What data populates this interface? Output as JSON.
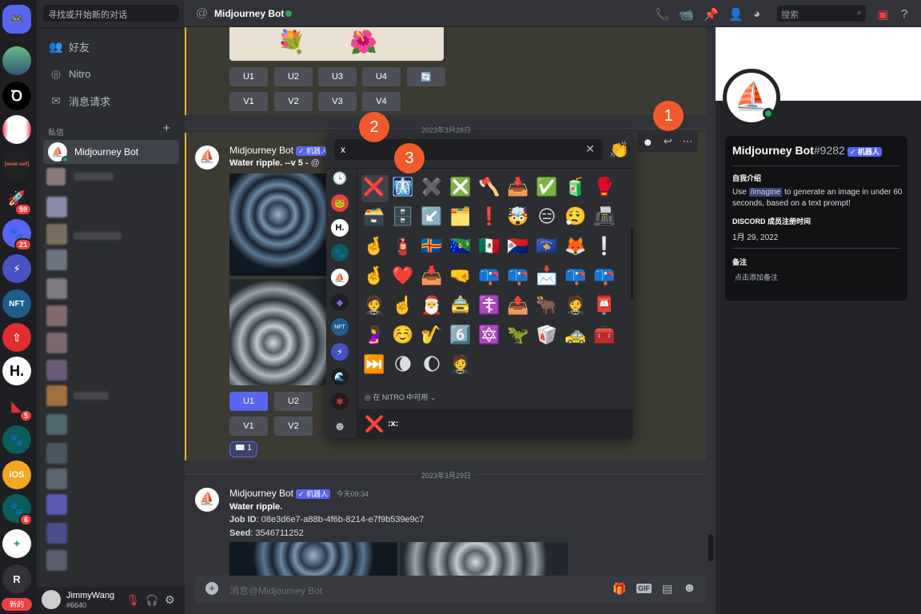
{
  "dm_sidebar": {
    "search_placeholder": "寻找或开始新的对话",
    "nav": [
      {
        "icon": "friends-icon",
        "label": "好友"
      },
      {
        "icon": "nitro-icon",
        "label": "Nitro"
      },
      {
        "icon": "mail-icon",
        "label": "消息请求"
      }
    ],
    "section_label": "私信",
    "add_label": "+",
    "active_dm": "Midjourney Bot"
  },
  "servers": {
    "badges": [
      "59",
      "21",
      "5",
      "6"
    ],
    "server_letters": [
      "H.",
      "R"
    ],
    "ios_label": "iOS",
    "nft_label": "NFT",
    "new_badge": "新的",
    "weak_label": "[weak self]"
  },
  "user": {
    "name": "JimmyWang",
    "tag": "#6640"
  },
  "header": {
    "at": "@",
    "title": "Midjourney Bot",
    "search_placeholder": "搜索"
  },
  "messages": {
    "upscale_row": [
      "U1",
      "U2",
      "U3",
      "U4"
    ],
    "variation_row": [
      "V1",
      "V2",
      "V3",
      "V4"
    ],
    "date1": "2023年3月28日",
    "msg1": {
      "author": "Midjourney Bot",
      "tag": "✓ 机器人",
      "prompt": "Water ripple. --v 5 -",
      "mention": "@",
      "buttons_u": [
        "U1",
        "U2"
      ],
      "buttons_v": [
        "V1",
        "V2"
      ],
      "reaction": "✉️ 1"
    },
    "date2": "2023年3月29日",
    "msg2": {
      "author": "Midjourney Bot",
      "tag": "✓ 机器人",
      "time": "今天09:34",
      "title": "Water ripple.",
      "job_label": "Job ID",
      "job_value": ": 08e3d6e7-a88b-4f6b-8214-e7f9b539e9c7",
      "seed_label": "Seed",
      "seed_value": ": 3546711252"
    }
  },
  "input": {
    "placeholder": "消息@Midjourney Bot",
    "gif": "GIF"
  },
  "picker": {
    "search_value": "x",
    "nitro_label": "在 NITRO 中可用",
    "preview_name": ":x:",
    "emojis": [
      "❌",
      "🩻",
      "✖️",
      "❎",
      "🪓",
      "📥",
      "✅",
      "🧃",
      "🥊",
      "🗃️",
      "🗄️",
      "↙️",
      "🗂️",
      "❗",
      "🤯",
      "😑",
      "😮‍💨",
      "📠",
      "🤞",
      "🧯",
      "🇦🇽",
      "🇨🇽",
      "🇲🇽",
      "🇸🇽",
      "🇽🇰",
      "🦊",
      "❕",
      "🤞",
      "❤️",
      "📥",
      "🤜",
      "📪",
      "📪",
      "📩",
      "📪",
      "📪",
      "🤵",
      "☝️",
      "🎅",
      "🚖",
      "☦️",
      "📤",
      "🐂",
      "🤵",
      "📮",
      "🤰",
      "☺️",
      "🎷",
      "6️⃣",
      "🔯",
      "🦖",
      "🥡",
      "🚕",
      "🧰",
      "⏭️",
      "🌘",
      "🌔",
      "🤵"
    ],
    "category_icons": [
      "clock-icon",
      "server-icon",
      "h-icon",
      "paw-icon",
      "boat-icon",
      "crystal-icon",
      "nft-icon",
      "bolt-icon",
      "wave-icon",
      "spider-icon",
      "smile-icon"
    ]
  },
  "callouts": [
    "1",
    "2",
    "3"
  ],
  "profile": {
    "name": "Midjourney Bot",
    "discriminator": "#9282",
    "tag": "✓ 机器人",
    "about_label": "自我介绍",
    "about_pre": "Use ",
    "about_cmd": "/imagine",
    "about_post": " to generate an image in under 60 seconds, based on a text prompt!",
    "member_label": "DISCORD 成员注册时间",
    "member_date": "1月 29, 2022",
    "note_label": "备注",
    "note_placeholder": "点击添加备注"
  },
  "colors": {
    "accent": "#5865f2",
    "callout": "#f05a2a",
    "online": "#23a55a",
    "danger": "#f23f43"
  }
}
